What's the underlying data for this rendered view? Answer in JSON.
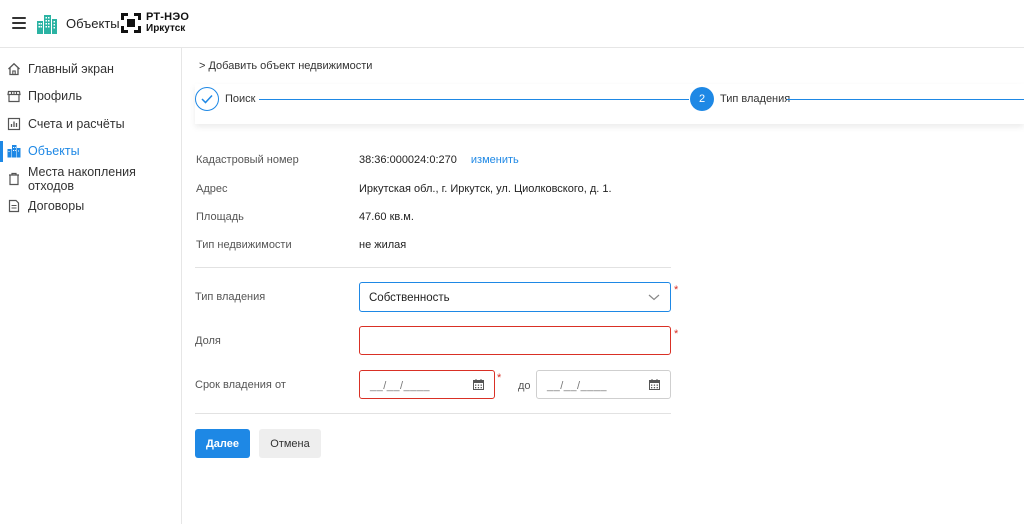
{
  "header": {
    "app_title": "Объекты",
    "logo_line1": "РТ-НЭО",
    "logo_line2": "Иркутск"
  },
  "sidebar": {
    "items": [
      {
        "label": "Главный экран",
        "icon": "home-icon"
      },
      {
        "label": "Профиль",
        "icon": "store-icon"
      },
      {
        "label": "Счета и расчёты",
        "icon": "chart-icon"
      },
      {
        "label": "Объекты",
        "icon": "buildings-icon",
        "active": true
      },
      {
        "label": "Места накопления отходов",
        "icon": "trash-icon"
      },
      {
        "label": "Договоры",
        "icon": "document-icon"
      }
    ]
  },
  "breadcrumb": "> Добавить объект недвижимости",
  "stepper": {
    "step1_label": "Поиск",
    "step2_number": "2",
    "step2_label": "Тип владения"
  },
  "info": {
    "cadastral_label": "Кадастровый номер",
    "cadastral_value": "38:36:000024:0:270",
    "change_link": "изменить",
    "address_label": "Адрес",
    "address_value": "Иркутская обл., г. Иркутск, ул. Циолковского,  д. 1.",
    "area_label": "Площадь",
    "area_value": "47.60 кв.м.",
    "type_label": "Тип недвижимости",
    "type_value": "не жилая"
  },
  "form": {
    "ownership_label": "Тип владения",
    "ownership_value": "Собственность",
    "share_label": "Доля",
    "share_value": "",
    "period_label": "Срок владения от",
    "date_from": "__/__/____",
    "until_label": "до",
    "date_to": "__/__/____",
    "required_mark": "*"
  },
  "buttons": {
    "next": "Далее",
    "cancel": "Отмена"
  },
  "colors": {
    "accent": "#1e88e5",
    "error": "#d93025"
  }
}
